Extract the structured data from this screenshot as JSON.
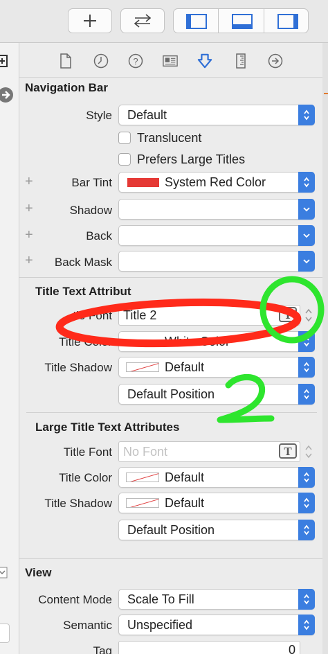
{
  "toolbar": {
    "add_icon": "plus-icon",
    "swap_icon": "swap-arrows-icon",
    "left_panel_icon": "left-panel-icon",
    "bottom_panel_icon": "bottom-panel-icon",
    "right_panel_icon": "right-panel-icon"
  },
  "tabs": [
    "file-inspector-icon",
    "history-icon",
    "help-icon",
    "identity-icon",
    "attributes-icon",
    "size-icon",
    "connections-icon"
  ],
  "navigation_bar": {
    "header": "Navigation Bar",
    "style_label": "Style",
    "style_value": "Default",
    "translucent_label": "Translucent",
    "prefers_large_titles_label": "Prefers Large Titles",
    "bar_tint_label": "Bar Tint",
    "bar_tint_value": "System Red Color",
    "bar_tint_color": "#e53935",
    "shadow_label": "Shadow",
    "back_label": "Back",
    "back_mask_label": "Back Mask"
  },
  "title_text": {
    "header": "Title Text Attribut",
    "font_label": "tle Font",
    "font_value": "Title 2",
    "color_label": "Title Color",
    "color_value": "White Color",
    "shadow_label": "Title Shadow",
    "shadow_value": "Default",
    "position_value": "Default Position"
  },
  "large_title_text": {
    "header": "Large Title Text Attributes",
    "font_label": "Title Font",
    "font_placeholder": "No Font",
    "color_label": "Title Color",
    "color_value": "Default",
    "shadow_label": "Title Shadow",
    "shadow_value": "Default",
    "position_value": "Default Position"
  },
  "view": {
    "header": "View",
    "content_mode_label": "Content Mode",
    "content_mode_value": "Scale To Fill",
    "semantic_label": "Semantic",
    "semantic_value": "Unspecified",
    "tag_label": "Tag",
    "tag_value": "0"
  },
  "annotations": {
    "red_color": "#ff2a1a",
    "green_color": "#2ee52e",
    "number": "2"
  }
}
